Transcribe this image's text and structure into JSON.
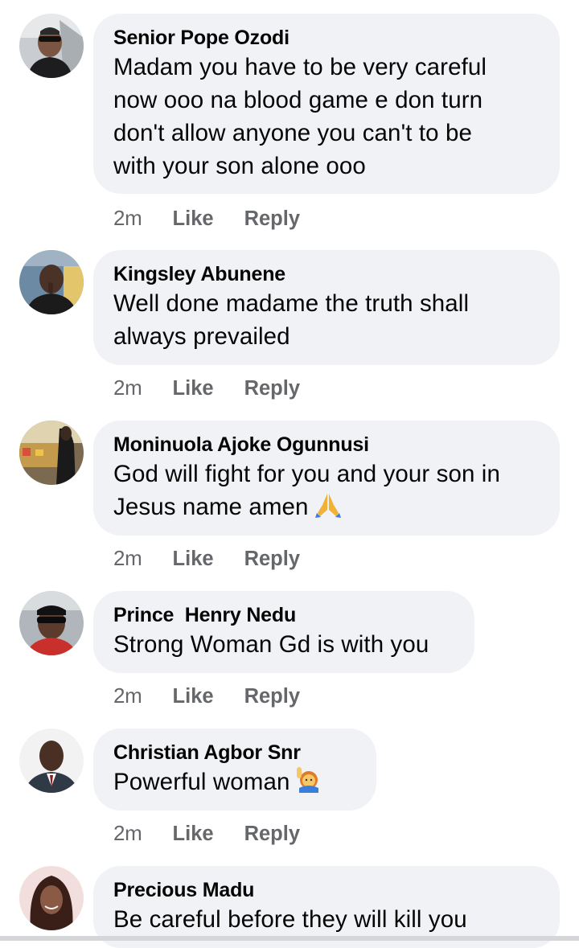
{
  "comments": [
    {
      "author": "Senior Pope Ozodi",
      "text": "Madam you have to be very careful\nnow ooo na blood game e don turn\ndon't allow anyone you can't to be\nwith your son alone ooo",
      "emoji": "",
      "time": "2m",
      "like_label": "Like",
      "reply_label": "Reply"
    },
    {
      "author": "Kingsley Abunene",
      "text": "Well done madame the truth shall\nalways prevailed",
      "emoji": "",
      "time": "2m",
      "like_label": "Like",
      "reply_label": "Reply"
    },
    {
      "author": "Moninuola Ajoke Ogunnusi",
      "text": "God will fight for you and your son in\nJesus name amen",
      "emoji": "folded-hands",
      "time": "2m",
      "like_label": "Like",
      "reply_label": "Reply"
    },
    {
      "author": "Prince  Henry Nedu",
      "text": "Strong Woman Gd is with you",
      "emoji": "",
      "time": "2m",
      "like_label": "Like",
      "reply_label": "Reply"
    },
    {
      "author": "Christian Agbor Snr",
      "text": "Powerful woman",
      "emoji": "woman-raising-hand",
      "time": "2m",
      "like_label": "Like",
      "reply_label": "Reply"
    },
    {
      "author": "Precious Madu",
      "text": "Be careful before they will kill you",
      "emoji": "",
      "time": "",
      "like_label": "",
      "reply_label": ""
    }
  ],
  "colors": {
    "bubble": "#f0f2f5",
    "secondary_text": "#65676b",
    "primary_text": "#050505"
  }
}
